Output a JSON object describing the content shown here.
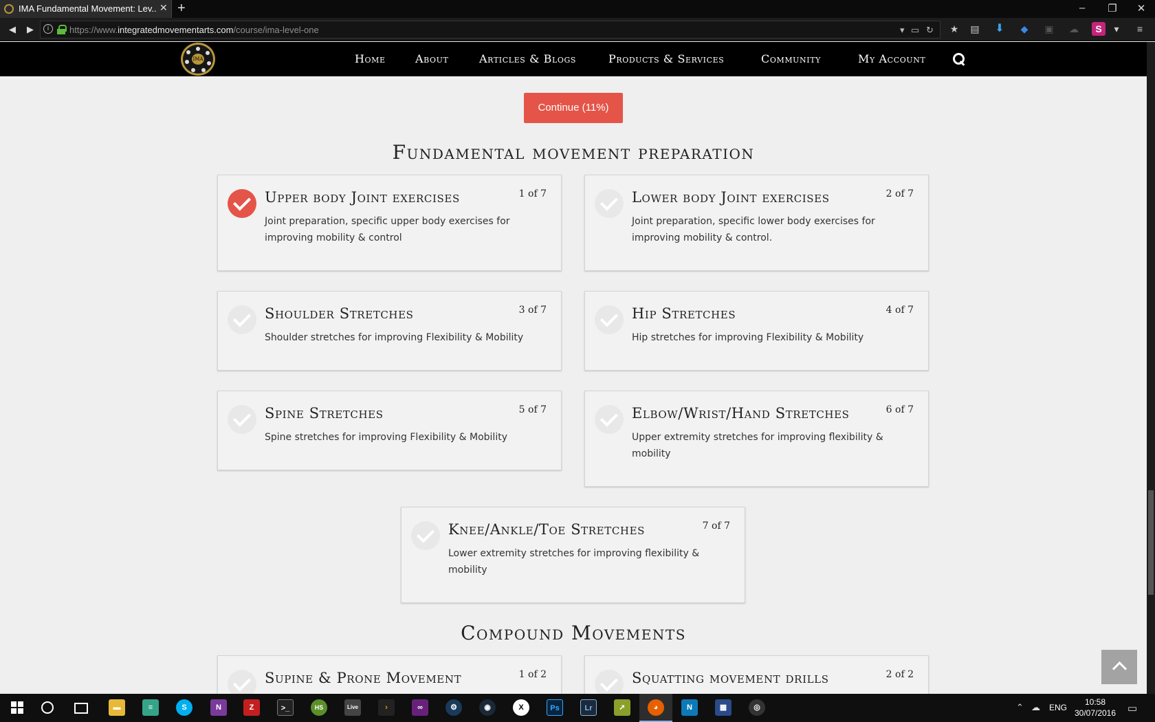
{
  "browser": {
    "tab_title": "IMA Fundamental Movement: Lev...",
    "tab_close": "✕",
    "new_tab": "+",
    "url_domain_prefix": "https://www.",
    "url_domain": "integratedmovementarts.com",
    "url_path": "/course/ima-level-one"
  },
  "site": {
    "logo_text": "IMA",
    "nav": [
      "Home",
      "About",
      "Articles & Blogs",
      "Products & Services",
      "Community",
      "My Account"
    ],
    "search_icon": "search-icon"
  },
  "course": {
    "continue_label": "Continue (11%)",
    "progress_percent": 11
  },
  "sections": [
    {
      "title": "Fundamental movement preparation",
      "lessons": [
        {
          "title": "Upper body Joint exercises",
          "count": "1 of 7",
          "desc": "Joint preparation, specific upper body exercises for improving mobility & control",
          "completed": true
        },
        {
          "title": "Lower body Joint exercises",
          "count": "2 of 7",
          "desc": "Joint preparation, specific lower body exercises for improving mobility & control.",
          "completed": false
        },
        {
          "title": "Shoulder Stretches",
          "count": "3 of 7",
          "desc": "Shoulder stretches for improving Flexibility & Mobility",
          "completed": false
        },
        {
          "title": "Hip Stretches",
          "count": "4 of 7",
          "desc": "Hip stretches for improving Flexibility & Mobility",
          "completed": false
        },
        {
          "title": "Spine Stretches",
          "count": "5 of 7",
          "desc": "Spine stretches for improving Flexibility & Mobility",
          "completed": false
        },
        {
          "title": "Elbow/Wrist/Hand Stretches",
          "count": "6 of 7",
          "desc": "Upper extremity stretches for improving flexibility & mobility",
          "completed": false
        },
        {
          "title": "Knee/Ankle/Toe Stretches",
          "count": "7 of 7",
          "desc": "Lower extremity stretches for improving flexibility & mobility",
          "completed": false
        }
      ]
    },
    {
      "title": "Compound Movements",
      "lessons": [
        {
          "title": "Supine & Prone Movement",
          "count": "1 of 2",
          "completed": false
        },
        {
          "title": "Squatting movement drills",
          "count": "2 of 2",
          "completed": false
        }
      ]
    }
  ],
  "taskbar": {
    "language": "ENG",
    "time": "10:58",
    "date": "30/07/2016",
    "apps": [
      "file-explorer",
      "sheets",
      "skype",
      "onenote",
      "filezilla",
      "terminal",
      "hotspot-shield",
      "live",
      "plex",
      "visual-studio",
      "app-circle",
      "steam",
      "xbox",
      "photoshop",
      "lightroom",
      "app-arrow",
      "firefox",
      "notepad",
      "app-monitor",
      "obs"
    ]
  },
  "colors": {
    "accent": "#e55448",
    "header_bg": "#000000",
    "page_bg": "#efeff0",
    "card_bg": "#f2f2f2",
    "logo_gold": "#b8963a"
  }
}
